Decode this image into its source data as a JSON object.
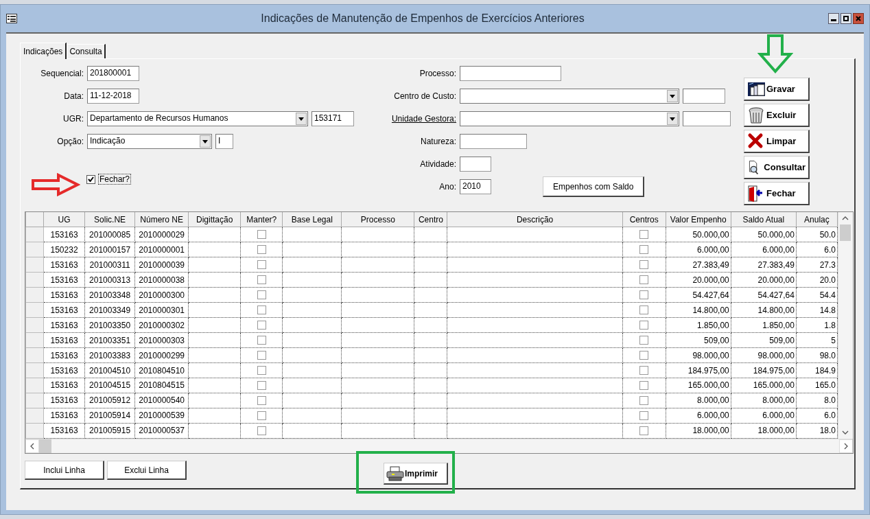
{
  "window": {
    "title": "Indicações de Manutenção de Empenhos de Exercícios Anteriores"
  },
  "tabs": [
    {
      "label": "Indicações",
      "selected": true
    },
    {
      "label": "Consulta",
      "selected": false
    }
  ],
  "left_fields": [
    {
      "label": "Sequencial:",
      "kind": "text",
      "value": "201800001"
    },
    {
      "label": "Data:",
      "kind": "text",
      "value": "11-12-2018"
    },
    {
      "label": "UGR:",
      "kind": "combo",
      "value": "Departamento de Recursos Humanos",
      "code": "153171"
    },
    {
      "label": "Opção:",
      "kind": "combo",
      "value": "Indicação",
      "code": "I"
    }
  ],
  "fechar_checkbox": {
    "label": "Fechar?",
    "checked": true
  },
  "right_fields": [
    {
      "label": "Processo:",
      "kind": "text",
      "underlined": false
    },
    {
      "label": "Centro de Custo:",
      "kind": "combo",
      "underlined": false
    },
    {
      "label": "Unidade Gestora:",
      "kind": "combo",
      "underlined": true
    },
    {
      "label": "Natureza:",
      "kind": "text",
      "underlined": false
    },
    {
      "label": "Atividade:",
      "kind": "text",
      "underlined": false
    },
    {
      "label": "Ano:",
      "kind": "text",
      "value": "2010",
      "underlined": false
    }
  ],
  "saldo_button": "Empenhos com  Saldo",
  "action_buttons": [
    {
      "label": "Gravar",
      "kind": "save"
    },
    {
      "label": "Excluir",
      "kind": "delete"
    },
    {
      "label": "Limpar",
      "kind": "clear"
    },
    {
      "label": "Consultar",
      "kind": "query"
    },
    {
      "label": "Fechar",
      "kind": "exit"
    }
  ],
  "table": {
    "columns": [
      {
        "label": "UG",
        "kind": "text"
      },
      {
        "label": "Solic.NE",
        "kind": "text"
      },
      {
        "label": "Número NE",
        "kind": "text"
      },
      {
        "label": "Digittação",
        "kind": "text"
      },
      {
        "label": "Manter?",
        "kind": "check"
      },
      {
        "label": "Base Legal",
        "kind": "text"
      },
      {
        "label": "Processo",
        "kind": "text"
      },
      {
        "label": "Centro",
        "kind": "text"
      },
      {
        "label": "Descrição",
        "kind": "text"
      },
      {
        "label": "Centros",
        "kind": "check"
      },
      {
        "label": "Valor Empenho",
        "kind": "number"
      },
      {
        "label": "Saldo Atual",
        "kind": "number"
      },
      {
        "label": "Anulaç",
        "kind": "number"
      }
    ],
    "rows": [
      {
        "ug": "153163",
        "solic_ne": "201000085",
        "numero_ne": "2010000029",
        "manter": false,
        "centros": false,
        "valor_empenho": "50.000,00",
        "saldo_atual": "50.000,00",
        "anulacao": "50.0"
      },
      {
        "ug": "150232",
        "solic_ne": "201000157",
        "numero_ne": "2010000001",
        "manter": false,
        "centros": false,
        "valor_empenho": "6.000,00",
        "saldo_atual": "6.000,00",
        "anulacao": "6.0"
      },
      {
        "ug": "153163",
        "solic_ne": "201000311",
        "numero_ne": "2010000039",
        "manter": false,
        "centros": false,
        "valor_empenho": "27.383,49",
        "saldo_atual": "27.383,49",
        "anulacao": "27.3"
      },
      {
        "ug": "153163",
        "solic_ne": "201000313",
        "numero_ne": "2010000038",
        "manter": false,
        "centros": false,
        "valor_empenho": "20.000,00",
        "saldo_atual": "20.000,00",
        "anulacao": "20.0"
      },
      {
        "ug": "153163",
        "solic_ne": "201003348",
        "numero_ne": "2010000300",
        "manter": false,
        "centros": false,
        "valor_empenho": "54.427,64",
        "saldo_atual": "54.427,64",
        "anulacao": "54.4"
      },
      {
        "ug": "153163",
        "solic_ne": "201003349",
        "numero_ne": "2010000301",
        "manter": false,
        "centros": false,
        "valor_empenho": "14.800,00",
        "saldo_atual": "14.800,00",
        "anulacao": "14.8"
      },
      {
        "ug": "153163",
        "solic_ne": "201003350",
        "numero_ne": "2010000302",
        "manter": false,
        "centros": false,
        "valor_empenho": "1.850,00",
        "saldo_atual": "1.850,00",
        "anulacao": "1.8"
      },
      {
        "ug": "153163",
        "solic_ne": "201003351",
        "numero_ne": "2010000303",
        "manter": false,
        "centros": false,
        "valor_empenho": "509,00",
        "saldo_atual": "509,00",
        "anulacao": "5"
      },
      {
        "ug": "153163",
        "solic_ne": "201003383",
        "numero_ne": "2010000299",
        "manter": false,
        "centros": false,
        "valor_empenho": "98.000,00",
        "saldo_atual": "98.000,00",
        "anulacao": "98.0"
      },
      {
        "ug": "153163",
        "solic_ne": "201004510",
        "numero_ne": "2010804510",
        "manter": false,
        "centros": false,
        "valor_empenho": "184.975,00",
        "saldo_atual": "184.975,00",
        "anulacao": "184.9"
      },
      {
        "ug": "153163",
        "solic_ne": "201004515",
        "numero_ne": "2010804515",
        "manter": false,
        "centros": false,
        "valor_empenho": "165.000,00",
        "saldo_atual": "165.000,00",
        "anulacao": "165.0"
      },
      {
        "ug": "153163",
        "solic_ne": "201005912",
        "numero_ne": "2010000540",
        "manter": false,
        "centros": false,
        "valor_empenho": "8.000,00",
        "saldo_atual": "8.000,00",
        "anulacao": "8.0"
      },
      {
        "ug": "153163",
        "solic_ne": "201005914",
        "numero_ne": "2010000539",
        "manter": false,
        "centros": false,
        "valor_empenho": "6.000,00",
        "saldo_atual": "6.000,00",
        "anulacao": "6.0"
      },
      {
        "ug": "153163",
        "solic_ne": "201005915",
        "numero_ne": "2010000537",
        "manter": false,
        "centros": false,
        "valor_empenho": "18.000,00",
        "saldo_atual": "18.000,00",
        "anulacao": "18.0"
      }
    ]
  },
  "bottom_buttons": [
    "Inclui Linha",
    "Exclui Linha"
  ],
  "print_button": "Imprimir"
}
